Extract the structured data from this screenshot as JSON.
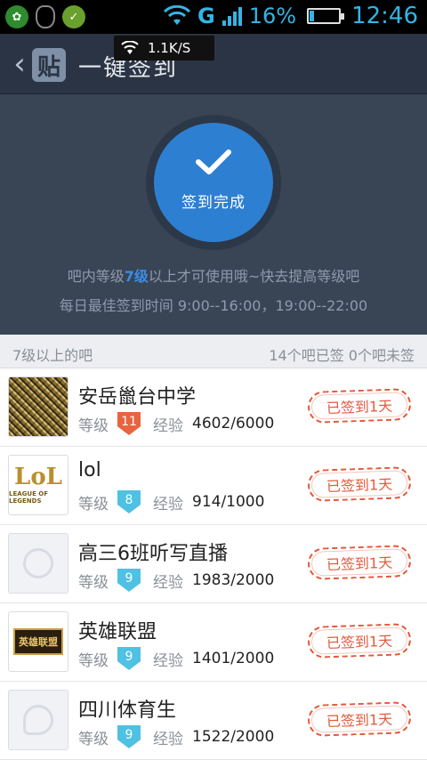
{
  "statusbar": {
    "network": "G",
    "battery": "16%",
    "battery_level": 0.16,
    "time": "12:46"
  },
  "header": {
    "logo": "贴",
    "title": "一键签到"
  },
  "toast": {
    "speed": "1.1K/S"
  },
  "sign": {
    "button_label": "签到完成",
    "tip_prefix": "吧内等级",
    "tip_level": "7级",
    "tip_suffix": "以上才可使用哦~快去提高等级吧",
    "time_tip": "每日最佳签到时间 9:00--16:00，19:00--22:00"
  },
  "section": {
    "left": "7级以上的吧",
    "right": "14个吧已签 0个吧未签"
  },
  "forums": [
    {
      "name": "安岳巤台中学",
      "level_label": "等级",
      "level": "11",
      "level_color": "#e8633f",
      "exp_label": "经验",
      "exp": "4602/6000",
      "status": "已签到1天",
      "avatar": "qr"
    },
    {
      "name": "lol",
      "level_label": "等级",
      "level": "8",
      "level_color": "#4fc1e3",
      "exp_label": "经验",
      "exp": "914/1000",
      "status": "已签到1天",
      "avatar": "lol"
    },
    {
      "name": "高三6班听写直播",
      "level_label": "等级",
      "level": "9",
      "level_color": "#4fc1e3",
      "exp_label": "经验",
      "exp": "1983/2000",
      "status": "已签到1天",
      "avatar": "blank"
    },
    {
      "name": "英雄联盟",
      "level_label": "等级",
      "level": "9",
      "level_color": "#4fc1e3",
      "exp_label": "经验",
      "exp": "1401/2000",
      "status": "已签到1天",
      "avatar": "hero"
    },
    {
      "name": "四川体育生",
      "level_label": "等级",
      "level": "9",
      "level_color": "#4fc1e3",
      "exp_label": "经验",
      "exp": "1522/2000",
      "status": "已签到1天",
      "avatar": "chat"
    }
  ],
  "avatar_text": {
    "lol_big": "LoL",
    "lol_small": "LEAGUE OF LEGENDS",
    "hero": "英雄联盟"
  },
  "colors": {
    "header_bg": "#2a3444",
    "panel_bg": "#394455",
    "button_blue": "#2d7fd1",
    "stamp_red": "#e15a3c",
    "status_blue": "#33b5e5"
  }
}
